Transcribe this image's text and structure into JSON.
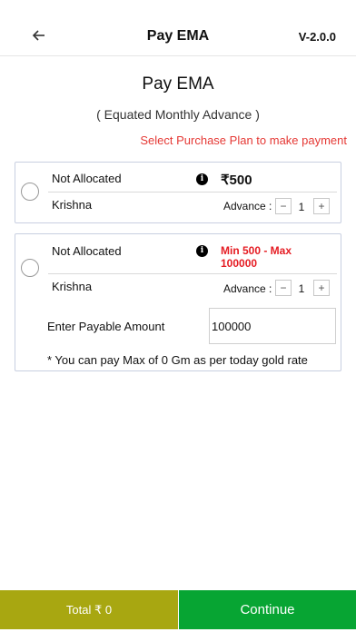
{
  "header": {
    "title": "Pay EMA",
    "version": "V-2.0.0",
    "back_icon": "arrow-left-icon"
  },
  "page": {
    "title": "Pay EMA",
    "subtitle": "( Equated Monthly Advance )",
    "hint": "Select Purchase Plan to make payment"
  },
  "plans": [
    {
      "status": "Not Allocated",
      "amount": "₹500",
      "name": "Krishna",
      "advance_label": "Advance :",
      "advance_value": "1",
      "selected": false
    },
    {
      "status": "Not Allocated",
      "range": "Min 500 - Max 100000",
      "name": "Krishna",
      "advance_label": "Advance :",
      "advance_value": "1",
      "payable_label": "Enter Payable Amount",
      "payable_value": "100000",
      "note": "* You can pay Max of 0 Gm as per today gold rate",
      "selected": false
    }
  ],
  "footer": {
    "total": "Total  ₹ 0",
    "continue_label": "Continue",
    "total_color": "#a8a711",
    "continue_color": "#07a533"
  },
  "colors": {
    "hint": "#e53935",
    "range": "#e51c23",
    "card_border": "#c8cfe0"
  }
}
